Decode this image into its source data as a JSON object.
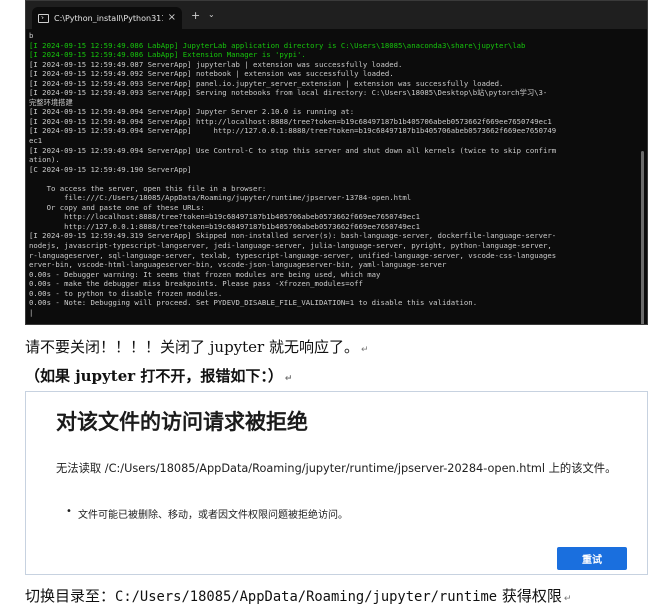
{
  "terminal": {
    "tab_title": "C:\\Python_install\\Python311\\",
    "close_glyph": "×",
    "new_tab_glyph": "+",
    "dropdown_glyph": "⌄",
    "lines": [
      {
        "text": "b",
        "style": "normal"
      },
      {
        "text": "[I 2024-09-15 12:59:49.086 LabApp] JupyterLab application directory is C:\\Users\\18085\\anaconda3\\share\\jupyter\\lab",
        "style": "green"
      },
      {
        "text": "[I 2024-09-15 12:59:49.086 LabApp] Extension Manager is 'pypi'.",
        "style": "green"
      },
      {
        "text": "[I 2024-09-15 12:59:49.087 ServerApp] jupyterlab | extension was successfully loaded.",
        "style": "normal"
      },
      {
        "text": "[I 2024-09-15 12:59:49.092 ServerApp] notebook | extension was successfully loaded.",
        "style": "normal"
      },
      {
        "text": "[I 2024-09-15 12:59:49.093 ServerApp] panel.io.jupyter_server_extension | extension was successfully loaded.",
        "style": "normal"
      },
      {
        "text": "[I 2024-09-15 12:59:49.093 ServerApp] Serving notebooks from local directory: C:\\Users\\18085\\Desktop\\b站\\pytorch学习\\3-",
        "style": "normal"
      },
      {
        "text": "完整环境搭建",
        "style": "normal"
      },
      {
        "text": "[I 2024-09-15 12:59:49.094 ServerApp] Jupyter Server 2.10.0 is running at:",
        "style": "normal"
      },
      {
        "text": "[I 2024-09-15 12:59:49.094 ServerApp] http://localhost:8888/tree?token=b19c68497187b1b405706abeb0573662f669ee7650749ec1",
        "style": "normal"
      },
      {
        "text": "[I 2024-09-15 12:59:49.094 ServerApp]     http://127.0.0.1:8888/tree?token=b19c68497187b1b405706abeb0573662f669ee7650749",
        "style": "normal"
      },
      {
        "text": "ec1",
        "style": "normal"
      },
      {
        "text": "[I 2024-09-15 12:59:49.094 ServerApp] Use Control-C to stop this server and shut down all kernels (twice to skip confirm",
        "style": "normal"
      },
      {
        "text": "ation).",
        "style": "normal"
      },
      {
        "text": "[C 2024-09-15 12:59:49.190 ServerApp]",
        "style": "normal"
      },
      {
        "text": "",
        "style": "normal"
      },
      {
        "text": "    To access the server, open this file in a browser:",
        "style": "normal"
      },
      {
        "text": "        file:///C:/Users/18085/AppData/Roaming/jupyter/runtime/jpserver-13784-open.html",
        "style": "normal"
      },
      {
        "text": "    Or copy and paste one of these URLs:",
        "style": "normal"
      },
      {
        "text": "        http://localhost:8888/tree?token=b19c68497187b1b405706abeb0573662f669ee7650749ec1",
        "style": "normal"
      },
      {
        "text": "        http://127.0.0.1:8888/tree?token=b19c68497187b1b405706abeb0573662f669ee7650749ec1",
        "style": "normal"
      },
      {
        "text": "[I 2024-09-15 12:59:49.319 ServerApp] Skipped non-installed server(s): bash-language-server, dockerfile-language-server-",
        "style": "normal"
      },
      {
        "text": "nodejs, javascript-typescript-langserver, jedi-language-server, julia-language-server, pyright, python-language-server,",
        "style": "normal"
      },
      {
        "text": "r-languageserver, sql-language-server, texlab, typescript-language-server, unified-language-server, vscode-css-languages",
        "style": "normal"
      },
      {
        "text": "erver-bin, vscode-html-languageserver-bin, vscode-json-languageserver-bin, yaml-language-server",
        "style": "normal"
      },
      {
        "text": "0.00s - Debugger warning: It seems that frozen modules are being used, which may",
        "style": "normal"
      },
      {
        "text": "0.00s - make the debugger miss breakpoints. Please pass -Xfrozen_modules=off",
        "style": "normal"
      },
      {
        "text": "0.00s - to python to disable frozen modules.",
        "style": "normal"
      },
      {
        "text": "0.00s - Note: Debugging will proceed. Set PYDEVD_DISABLE_FILE_VALIDATION=1 to disable this validation.",
        "style": "normal"
      },
      {
        "text": "|",
        "style": "normal"
      }
    ]
  },
  "doc": {
    "line1": "请不要关闭！！！！关闭了 jupyter 就无响应了。",
    "line2": "（如果 jupyter 打不开，报错如下：）",
    "line3_prefix": "切换目录至：",
    "line3_path": "C:/Users/18085/AppData/Roaming/jupyter/runtime",
    "line3_suffix": " 获得权限",
    "para_mark": "↵"
  },
  "error_page": {
    "title": "对该文件的访问请求被拒绝",
    "description": "无法读取 /C:/Users/18085/AppData/Roaming/jupyter/runtime/jpserver-20284-open.html 上的该文件。",
    "bullet": "文件可能已被删除、移动，或者因文件权限问题被拒绝访问。",
    "retry_label": "重试"
  }
}
